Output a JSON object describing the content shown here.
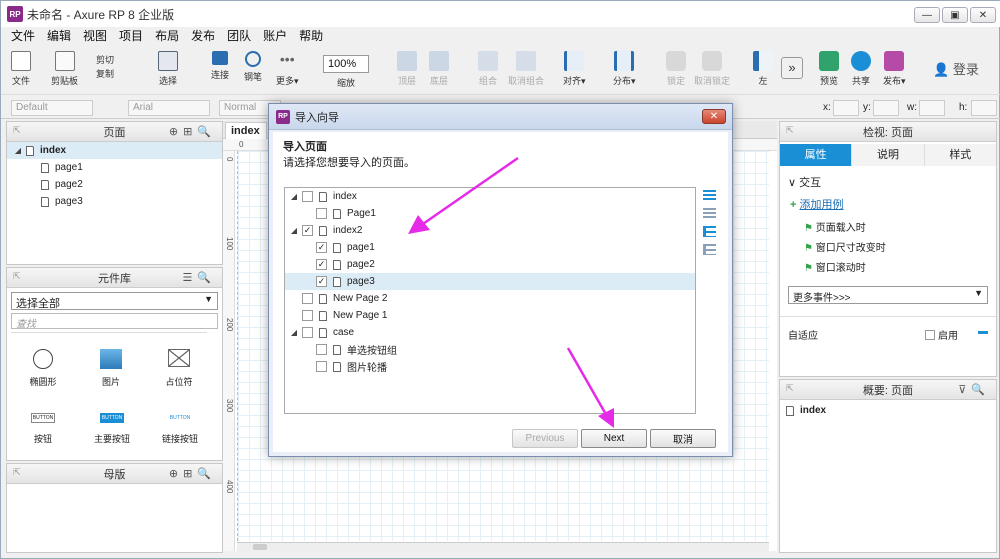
{
  "window": {
    "title": "未命名 - Axure RP 8 企业版",
    "app_badge": "RP"
  },
  "window_controls": {
    "minimize": "—",
    "restore": "▣",
    "close": "✕"
  },
  "menu": [
    "文件",
    "编辑",
    "视图",
    "项目",
    "布局",
    "发布",
    "团队",
    "账户",
    "帮助"
  ],
  "toolbar": {
    "file": "文件",
    "clipboard": "剪贴板",
    "cut": "剪切",
    "copy": "复制",
    "paste_label": "粘贴",
    "select": "选择",
    "connect": "连接",
    "pen": "钢笔",
    "more": "更多▾",
    "zoom_value": "100%",
    "zoom_label": "缩放",
    "top": "顶层",
    "bottom": "底层",
    "group": "组合",
    "ungroup": "取消组合",
    "align": "对齐▾",
    "distribute": "分布▾",
    "lock": "锁定",
    "unlock": "取消锁定",
    "left": "左",
    "preview": "预览",
    "share": "共享",
    "publish": "发布▾",
    "login": "登录"
  },
  "format_bar": {
    "style": "Default",
    "font": "Arial",
    "weight": "Normal",
    "x": "x:",
    "y": "y:",
    "w": "w:",
    "h": "h:"
  },
  "pages_panel": {
    "title": "页面",
    "root": "index",
    "children": [
      "page1",
      "page2",
      "page3"
    ]
  },
  "library_panel": {
    "title": "元件库",
    "select_value": "选择全部",
    "search_placeholder": "查找",
    "widgets": [
      "椭圆形",
      "图片",
      "占位符",
      "按钮",
      "主要按钮",
      "链接按钮"
    ],
    "button_preview": [
      "BUTTON",
      "BUTTON",
      "BUTTON"
    ]
  },
  "masters_panel": {
    "title": "母版"
  },
  "canvas": {
    "tab": "index",
    "ruler_top": [
      "0"
    ],
    "ruler_left": [
      "0",
      "100",
      "200",
      "300",
      "400"
    ]
  },
  "inspector": {
    "title": "检视: 页面",
    "tabs": [
      "属性",
      "说明",
      "样式"
    ],
    "section": "交互",
    "add_case": "添加用例",
    "events": [
      "页面载入时",
      "窗口尺寸改变时",
      "窗口滚动时"
    ],
    "more_events": "更多事件>>>",
    "adaptive": "自适应",
    "enable": "启用"
  },
  "outline": {
    "title": "概要: 页面",
    "item": "index"
  },
  "dialog": {
    "title": "导入向导",
    "heading": "导入页面",
    "subtitle": "请选择您想要导入的页面。",
    "rows": [
      {
        "label": "index",
        "level": 0,
        "checked": false,
        "expanded": true
      },
      {
        "label": "Page1",
        "level": 1,
        "checked": false
      },
      {
        "label": "index2",
        "level": 0,
        "checked": true,
        "expanded": true
      },
      {
        "label": "page1",
        "level": 1,
        "checked": true
      },
      {
        "label": "page2",
        "level": 1,
        "checked": true
      },
      {
        "label": "page3",
        "level": 1,
        "checked": true,
        "selected": true
      },
      {
        "label": "New Page 2",
        "level": 0,
        "checked": false
      },
      {
        "label": "New Page 1",
        "level": 0,
        "checked": false
      },
      {
        "label": "case",
        "level": 0,
        "checked": false,
        "expanded": true
      },
      {
        "label": "单选按钮组",
        "level": 1,
        "checked": false
      },
      {
        "label": "图片轮播",
        "level": 1,
        "checked": false
      }
    ],
    "previous": "Previous",
    "next": "Next",
    "cancel": "取消",
    "close": "✕"
  },
  "colors": {
    "accent": "#1a8fd6",
    "annotation": "#e52ae8",
    "rp_brand": "#8a2a8a"
  }
}
